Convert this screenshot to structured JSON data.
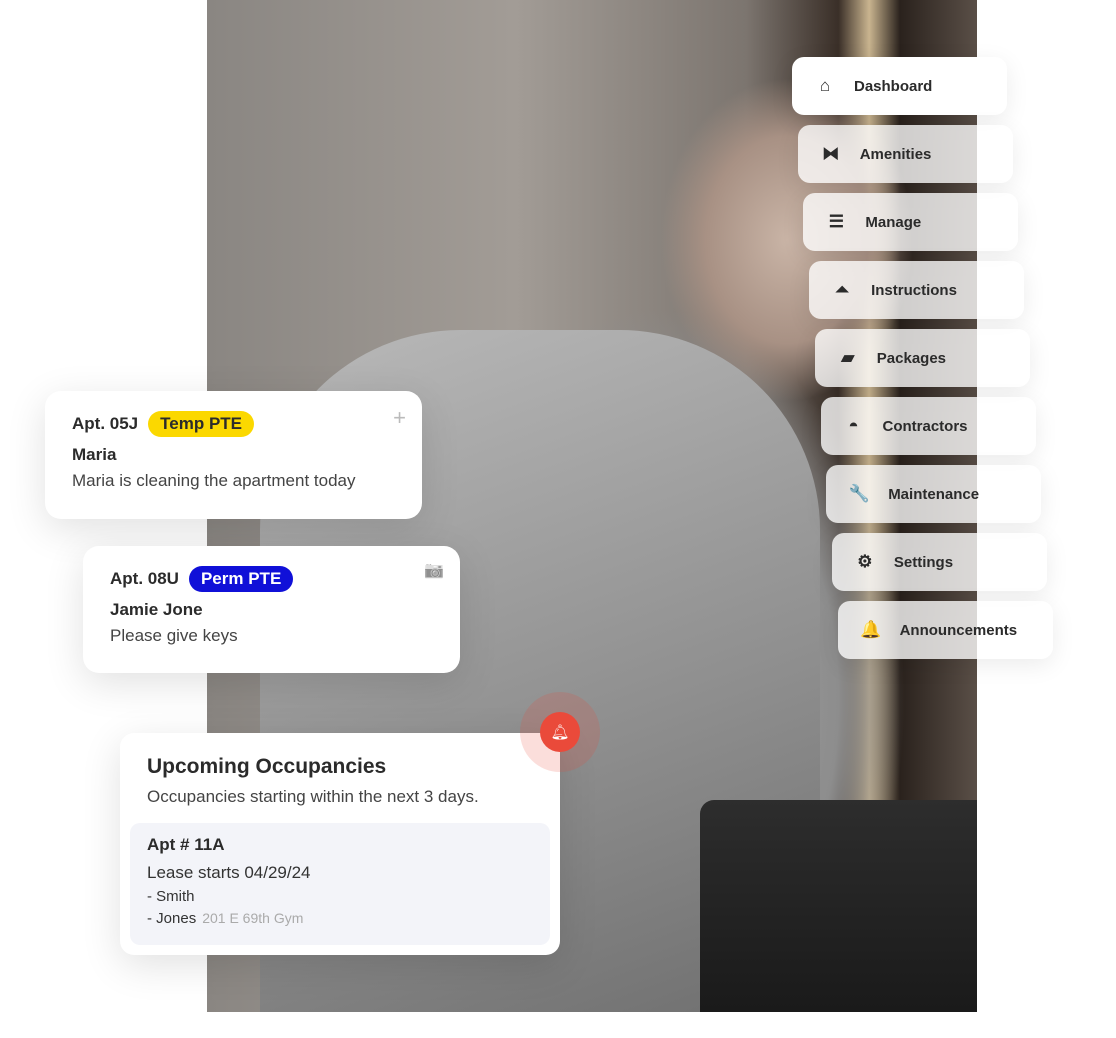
{
  "nav": [
    {
      "label": "Dashboard",
      "icon": "home-icon",
      "glyph": "⌂"
    },
    {
      "label": "Amenities",
      "icon": "dumbbell-icon",
      "glyph": "⧓"
    },
    {
      "label": "Manage",
      "icon": "checklist-icon",
      "glyph": "☰"
    },
    {
      "label": "Instructions",
      "icon": "concierge-bell-icon",
      "glyph": "⏶"
    },
    {
      "label": "Packages",
      "icon": "box-icon",
      "glyph": "▰"
    },
    {
      "label": "Contractors",
      "icon": "hard-hat-icon",
      "glyph": "◓"
    },
    {
      "label": "Maintenance",
      "icon": "wrench-icon",
      "glyph": "🔧"
    },
    {
      "label": "Settings",
      "icon": "gears-icon",
      "glyph": "⚙"
    },
    {
      "label": "Announcements",
      "icon": "bell-icon",
      "glyph": "🔔"
    }
  ],
  "cards": [
    {
      "apt": "Apt. 05J",
      "badge": "Temp PTE",
      "badge_color": "#fbd800",
      "badge_text_color": "#2b2b2b",
      "name": "Maria",
      "desc": "Maria is cleaning the apartment today",
      "corner_icon": "plus-icon",
      "corner_glyph": "+"
    },
    {
      "apt": "Apt. 08U",
      "badge": "Perm PTE",
      "badge_color": "#1010d8",
      "badge_text_color": "#ffffff",
      "name": "Jamie Jone",
      "desc": "Please give keys",
      "corner_icon": "camera-icon",
      "corner_glyph": "📷"
    }
  ],
  "occupancies": {
    "title": "Upcoming Occupancies",
    "subtitle": "Occupancies starting within the next 3 days.",
    "apt": "Apt # 11A",
    "lease": "Lease starts 04/29/24",
    "people": [
      "-  Smith",
      "-  Jones"
    ],
    "location": "201 E 69th Gym",
    "alert_color": "#ea4a3a"
  }
}
